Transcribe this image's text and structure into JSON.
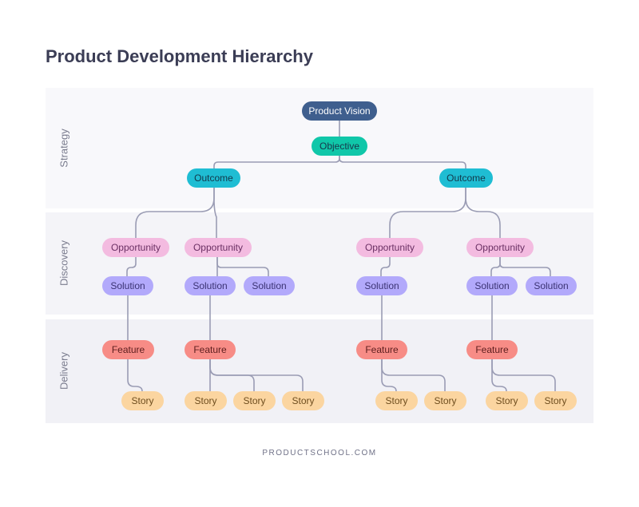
{
  "title": "Product Development Hierarchy",
  "footer": "PRODUCTSCHOOL.COM",
  "bands": {
    "strategy": "Strategy",
    "discovery": "Discovery",
    "delivery": "Delivery"
  },
  "nodes": {
    "vision": "Product Vision",
    "objective": "Objective",
    "outcome_1": "Outcome",
    "outcome_2": "Outcome",
    "opportunity_1": "Opportunity",
    "opportunity_2": "Opportunity",
    "opportunity_3": "Opportunity",
    "opportunity_4": "Opportunity",
    "solution_1": "Solution",
    "solution_2": "Solution",
    "solution_3": "Solution",
    "solution_4": "Solution",
    "solution_5": "Solution",
    "solution_6": "Solution",
    "feature_1": "Feature",
    "feature_2": "Feature",
    "feature_3": "Feature",
    "feature_4": "Feature",
    "story_1": "Story",
    "story_2": "Story",
    "story_3": "Story",
    "story_4": "Story",
    "story_5": "Story",
    "story_6": "Story",
    "story_7": "Story",
    "story_8": "Story"
  },
  "colors": {
    "vision": "#3f5f8e",
    "objective": "#10c7a9",
    "outcome": "#1fbdd3",
    "opportunity": "#f3bbe0",
    "solution": "#b2a9fb",
    "feature": "#f78c86",
    "story": "#fbd5a0",
    "connector": "#9a9cb4"
  }
}
